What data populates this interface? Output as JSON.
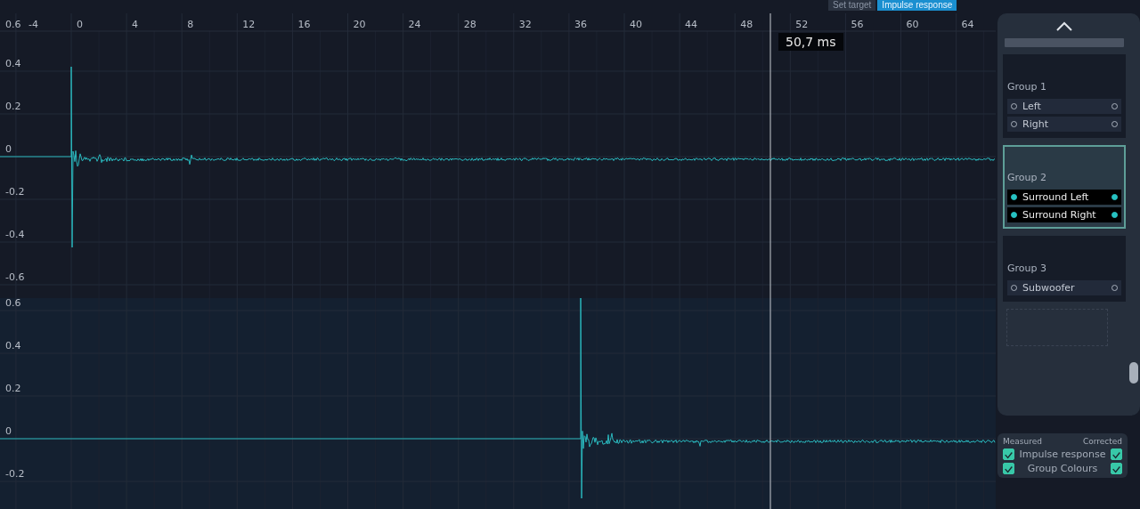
{
  "header_tabs": [
    {
      "label": "Set target",
      "selected": false
    },
    {
      "label": "Impulse response",
      "selected": true
    }
  ],
  "plot": {
    "x_ticks": [
      "-4",
      "0",
      "4",
      "8",
      "12",
      "16",
      "20",
      "24",
      "28",
      "32",
      "36",
      "40",
      "44",
      "48",
      "52",
      "56",
      "60",
      "64"
    ],
    "top_y_ticks": [
      "0.6",
      "0.4",
      "0.2",
      "0",
      "-0.2",
      "-0.4",
      "-0.6"
    ],
    "bottom_y_ticks": [
      "0.6",
      "0.4",
      "0.2",
      "0",
      "-0.2"
    ],
    "cursor_readout": "50,7 ms"
  },
  "groups": [
    {
      "title": "Group 1",
      "selected": false,
      "channels": [
        {
          "name": "Left",
          "active": false
        },
        {
          "name": "Right",
          "active": false
        }
      ]
    },
    {
      "title": "Group 2",
      "selected": true,
      "channels": [
        {
          "name": "Surround Left",
          "active": true
        },
        {
          "name": "Surround Right",
          "active": true
        }
      ]
    },
    {
      "title": "Group 3",
      "selected": false,
      "channels": [
        {
          "name": "Subwoofer",
          "active": false
        }
      ]
    }
  ],
  "legend": {
    "measured_label": "Measured",
    "corrected_label": "Corrected",
    "rows": [
      {
        "label": "Impulse response",
        "measured": true,
        "corrected": true
      },
      {
        "label": "Group Colours",
        "measured": true,
        "corrected": true
      }
    ]
  }
}
